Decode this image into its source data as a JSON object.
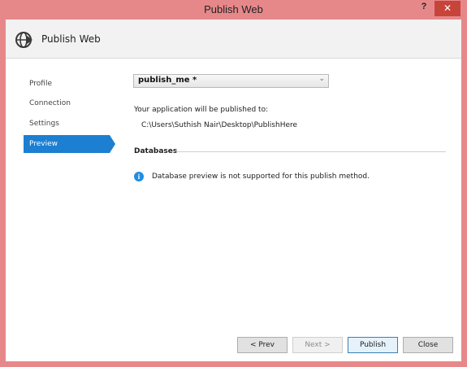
{
  "window": {
    "title": "Publish Web",
    "help_label": "?",
    "close_label": "✕"
  },
  "header": {
    "icon": "globe-publish-icon",
    "title": "Publish Web"
  },
  "sidebar": {
    "items": [
      {
        "label": "Profile",
        "active": false
      },
      {
        "label": "Connection",
        "active": false
      },
      {
        "label": "Settings",
        "active": false
      },
      {
        "label": "Preview",
        "active": true
      }
    ]
  },
  "main": {
    "profile_select": {
      "value": "publish_me *",
      "chevron": "⌄"
    },
    "publish_target_label": "Your application will be published to:",
    "publish_target_path": "C:\\Users\\Suthish Nair\\Desktop\\PublishHere",
    "databases_heading": "Databases",
    "info_icon": "info-icon",
    "info_symbol": "i",
    "database_message": "Database preview is not supported for this publish method."
  },
  "footer": {
    "prev_label": "< Prev",
    "next_label": "Next >",
    "publish_label": "Publish",
    "close_label": "Close"
  },
  "colors": {
    "title_bar": "#e6888a",
    "accent": "#1c7fd1",
    "close_button": "#c7443b"
  }
}
